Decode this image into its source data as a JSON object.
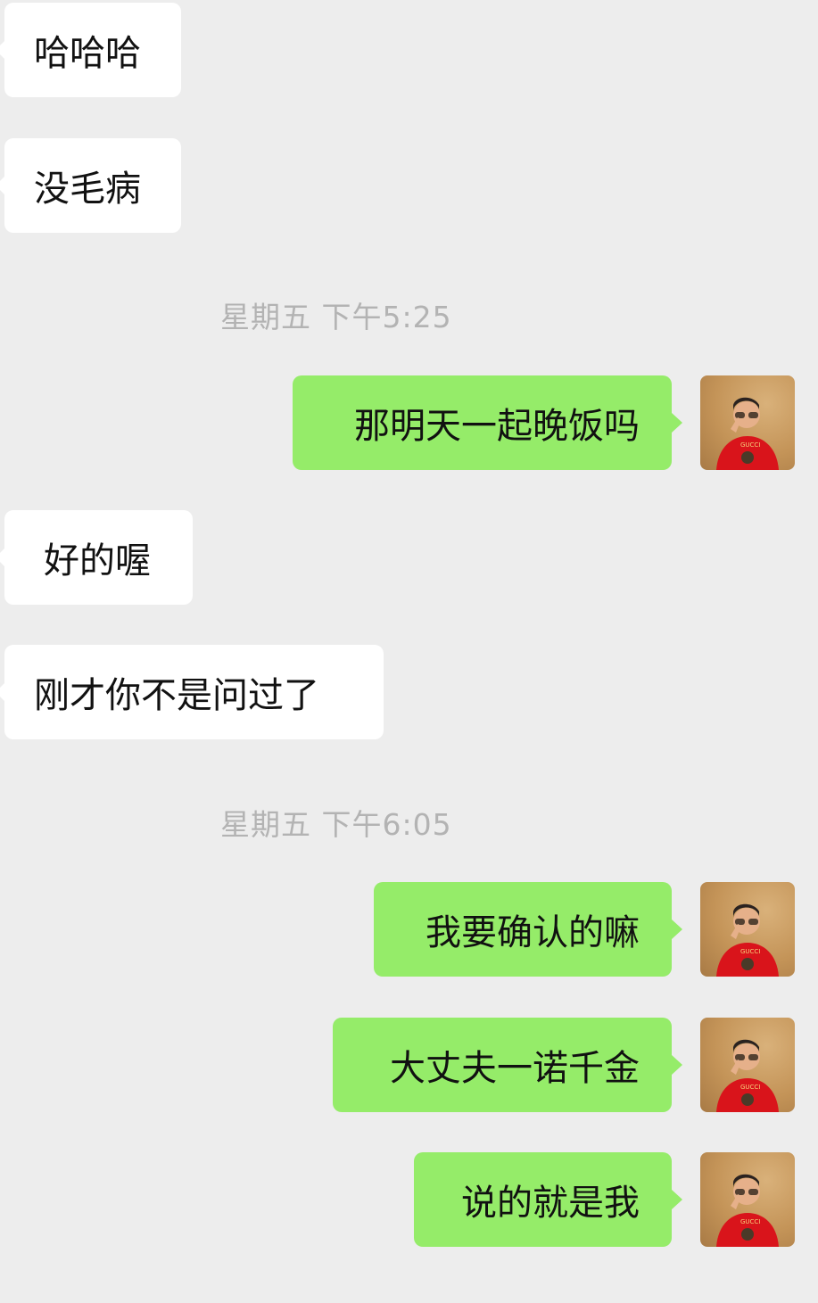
{
  "messages": [
    {
      "side": "in",
      "text": "哈哈哈"
    },
    {
      "side": "in",
      "text": "没毛病"
    },
    {
      "side": "time",
      "text": "星期五 下午5:25"
    },
    {
      "side": "out",
      "text": "那明天一起晚饭吗"
    },
    {
      "side": "in",
      "text": "好的喔"
    },
    {
      "side": "in",
      "text": "刚才你不是问过了"
    },
    {
      "side": "time",
      "text": "星期五 下午6:05"
    },
    {
      "side": "out",
      "text": "我要确认的嘛"
    },
    {
      "side": "out",
      "text": "大丈夫一诺千金"
    },
    {
      "side": "out",
      "text": "说的就是我"
    }
  ],
  "colors": {
    "background": "#ededed",
    "incoming_bubble": "#ffffff",
    "outgoing_bubble": "#95ec69",
    "timestamp_text": "#b3b3b3"
  },
  "icons": {
    "avatar": "user-avatar-photo"
  }
}
